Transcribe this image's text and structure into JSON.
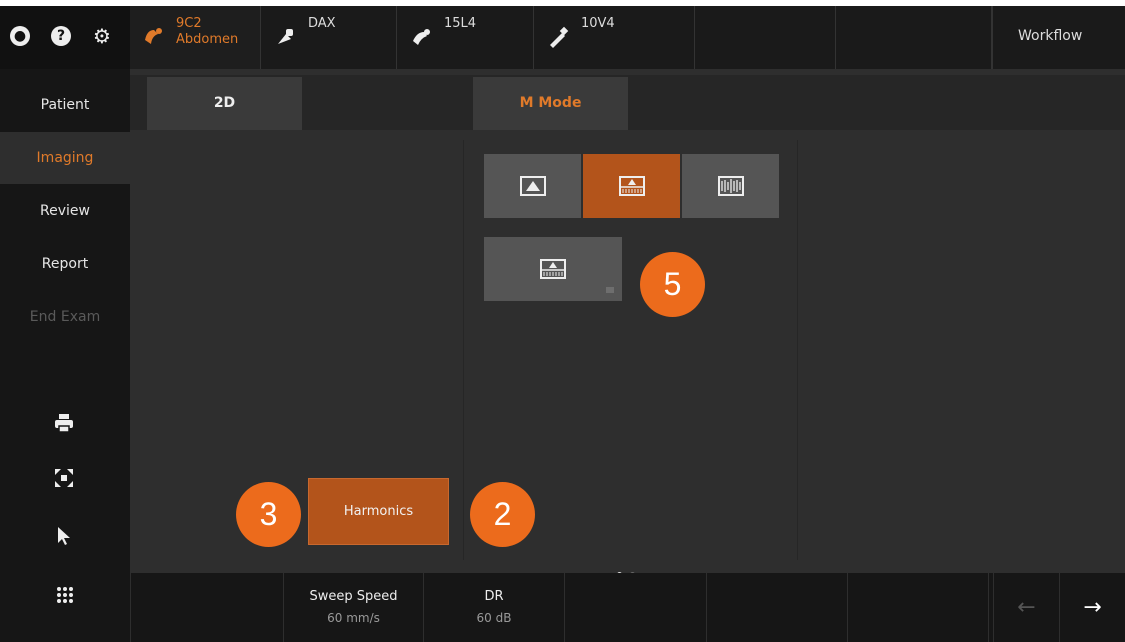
{
  "topbar": {
    "system_icons": [
      "user-icon",
      "help-icon",
      "settings-icon"
    ],
    "probes": [
      {
        "line1": "9C2",
        "line2": "Abdomen",
        "icon": "probe-curved-icon",
        "active": true
      },
      {
        "line1": "DAX",
        "line2": "",
        "icon": "probe-linear-icon",
        "active": false
      },
      {
        "line1": "15L4",
        "line2": "",
        "icon": "probe-hockey-icon",
        "active": false
      },
      {
        "line1": "10V4",
        "line2": "",
        "icon": "probe-pencil-icon",
        "active": false
      }
    ],
    "workflow_label": "Workflow"
  },
  "sidebar": {
    "items": [
      {
        "label": "Patient",
        "state": "normal"
      },
      {
        "label": "Imaging",
        "state": "active"
      },
      {
        "label": "Review",
        "state": "normal"
      },
      {
        "label": "Report",
        "state": "normal"
      },
      {
        "label": "End Exam",
        "state": "disabled"
      }
    ],
    "tools": [
      "print-icon",
      "fullscreen-icon",
      "pointer-icon",
      "apps-grid-icon"
    ]
  },
  "tabs": [
    {
      "label": "2D",
      "active": false
    },
    {
      "label": "M Mode",
      "active": true
    }
  ],
  "mmode": {
    "layout_tiles": [
      "full-image-icon",
      "split-image-sweep-icon",
      "sweep-only-icon"
    ],
    "selected_tile": 1,
    "secondary_tile": "split-image-sweep-icon"
  },
  "twod": {
    "harmonics_label": "Harmonics"
  },
  "callouts": {
    "a": "3",
    "b": "2",
    "c": "5"
  },
  "pager": {
    "pages": 2,
    "current": 1
  },
  "bottombar": {
    "params": [
      {
        "label": "Sweep Speed",
        "value": "60 mm/s"
      },
      {
        "label": "DR",
        "value": "60 dB"
      }
    ],
    "prev_arrow": "←",
    "next_arrow": "→"
  },
  "colors": {
    "accent": "#e07a2a",
    "active_tile": "#b3541b",
    "callout": "#ec6b1c"
  }
}
